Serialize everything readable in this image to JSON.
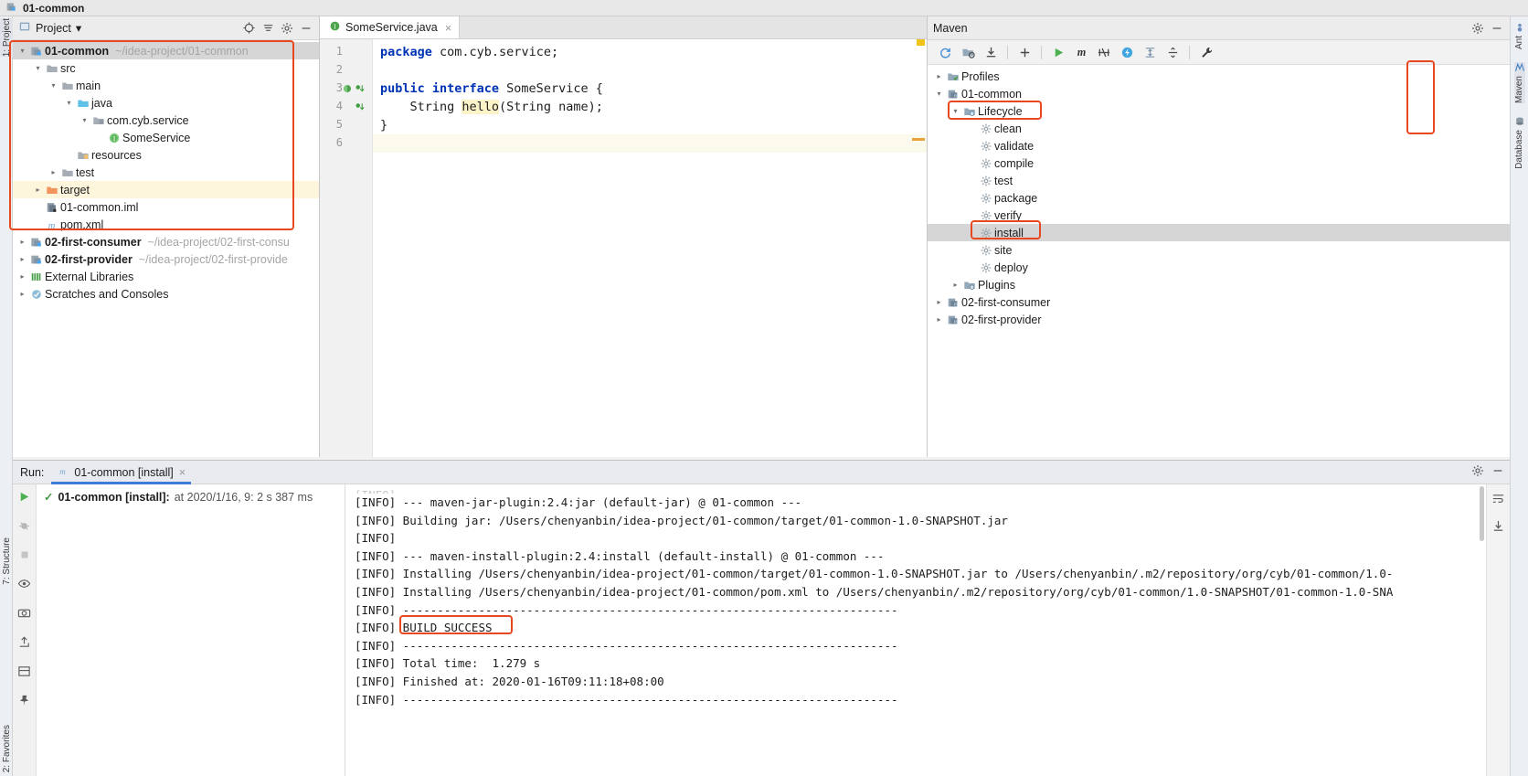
{
  "titlebar": {
    "project_name": "01-common",
    "icon": "module-icon"
  },
  "left_strip": {
    "project_tab": "1: Project",
    "structure_tab": "7: Structure",
    "favorites_tab": "2: Favorites"
  },
  "right_strip": {
    "ant_tab": "Ant",
    "maven_tab": "Maven",
    "database_tab": "Database"
  },
  "project_panel": {
    "header": {
      "title": "Project",
      "dropdown": "▾",
      "icons": [
        "locate-icon",
        "collapse-all-icon",
        "gear-icon",
        "minimize-icon"
      ]
    },
    "tree": [
      {
        "depth": 0,
        "arrow": "▾",
        "icon": "module-icon",
        "label": "01-common",
        "path": "~/idea-project/01-common",
        "bold": true,
        "selected": true
      },
      {
        "depth": 1,
        "arrow": "▾",
        "icon": "folder-icon",
        "label": "src",
        "path": "",
        "bold": false,
        "selected": false
      },
      {
        "depth": 2,
        "arrow": "▾",
        "icon": "folder-icon",
        "label": "main",
        "path": "",
        "bold": false,
        "selected": false
      },
      {
        "depth": 3,
        "arrow": "▾",
        "icon": "source-folder-icon",
        "label": "java",
        "path": "",
        "bold": false,
        "selected": false
      },
      {
        "depth": 4,
        "arrow": "▾",
        "icon": "package-icon",
        "label": "com.cyb.service",
        "path": "",
        "bold": false,
        "selected": false
      },
      {
        "depth": 5,
        "arrow": "",
        "icon": "interface-icon",
        "label": "SomeService",
        "path": "",
        "bold": false,
        "selected": false
      },
      {
        "depth": 3,
        "arrow": "",
        "icon": "resources-folder-icon",
        "label": "resources",
        "path": "",
        "bold": false,
        "selected": false
      },
      {
        "depth": 2,
        "arrow": "▸",
        "icon": "folder-icon",
        "label": "test",
        "path": "",
        "bold": false,
        "selected": false
      },
      {
        "depth": 1,
        "arrow": "▸",
        "icon": "target-folder-icon",
        "label": "target",
        "path": "",
        "bold": false,
        "selected": false,
        "highlight": true
      },
      {
        "depth": 1,
        "arrow": "",
        "icon": "iml-file-icon",
        "label": "01-common.iml",
        "path": "",
        "bold": false,
        "selected": false
      },
      {
        "depth": 1,
        "arrow": "",
        "icon": "maven-file-icon",
        "label": "pom.xml",
        "path": "",
        "bold": false,
        "selected": false
      },
      {
        "depth": 0,
        "arrow": "▸",
        "icon": "module-icon",
        "label": "02-first-consumer",
        "path": "~/idea-project/02-first-consu",
        "bold": true,
        "selected": false
      },
      {
        "depth": 0,
        "arrow": "▸",
        "icon": "module-icon",
        "label": "02-first-provider",
        "path": "~/idea-project/02-first-provide",
        "bold": true,
        "selected": false
      },
      {
        "depth": 0,
        "arrow": "▸",
        "icon": "libraries-icon",
        "label": "External Libraries",
        "path": "",
        "bold": false,
        "selected": false
      },
      {
        "depth": 0,
        "arrow": "▸",
        "icon": "scratches-icon",
        "label": "Scratches and Consoles",
        "path": "",
        "bold": false,
        "selected": false
      }
    ]
  },
  "editor": {
    "tab": {
      "label": "SomeService.java",
      "icon": "interface-icon",
      "close": "×"
    },
    "lines": [
      {
        "number": "1",
        "text": "package com.cyb.service;"
      },
      {
        "number": "2",
        "text": ""
      },
      {
        "number": "3",
        "text": "public interface SomeService {"
      },
      {
        "number": "4",
        "text": "    String hello(String name);"
      },
      {
        "number": "5",
        "text": "}"
      },
      {
        "number": "6",
        "text": ""
      }
    ],
    "code": {
      "l1_kw": "package",
      "l1_rest": " com.cyb.service;",
      "l3_kw": "public interface",
      "l3_rest": " SomeService {",
      "l4_pre": "    String ",
      "l4_hl": "hello",
      "l4_post": "(String name);",
      "l5": "}"
    },
    "gutter_icons": [
      "bookmark-green-icon",
      "run-gutter-icon",
      "implemented-icon"
    ]
  },
  "maven": {
    "title": "Maven",
    "header_icons": [
      "gear-icon",
      "minimize-icon"
    ],
    "toolbar": [
      "reload-icon",
      "generate-sources-icon",
      "download-sources-icon",
      "add-icon",
      "run-icon",
      "maven-goal-icon",
      "skip-tests-icon",
      "toggle-offline-icon",
      "expand-icon",
      "collapse-icon",
      "settings-wrench-icon"
    ],
    "tree": [
      {
        "depth": 0,
        "arrow": "▸",
        "icon": "profiles-icon",
        "label": "Profiles",
        "selected": false
      },
      {
        "depth": 0,
        "arrow": "▾",
        "icon": "maven-project-icon",
        "label": "01-common",
        "selected": false
      },
      {
        "depth": 1,
        "arrow": "▾",
        "icon": "lifecycle-icon",
        "label": "Lifecycle",
        "selected": false,
        "boxed": true
      },
      {
        "depth": 2,
        "arrow": "",
        "icon": "goal-icon",
        "label": "clean",
        "selected": false
      },
      {
        "depth": 2,
        "arrow": "",
        "icon": "goal-icon",
        "label": "validate",
        "selected": false
      },
      {
        "depth": 2,
        "arrow": "",
        "icon": "goal-icon",
        "label": "compile",
        "selected": false
      },
      {
        "depth": 2,
        "arrow": "",
        "icon": "goal-icon",
        "label": "test",
        "selected": false
      },
      {
        "depth": 2,
        "arrow": "",
        "icon": "goal-icon",
        "label": "package",
        "selected": false
      },
      {
        "depth": 2,
        "arrow": "",
        "icon": "goal-icon",
        "label": "verify",
        "selected": false
      },
      {
        "depth": 2,
        "arrow": "",
        "icon": "goal-icon",
        "label": "install",
        "selected": true,
        "boxed": true
      },
      {
        "depth": 2,
        "arrow": "",
        "icon": "goal-icon",
        "label": "site",
        "selected": false
      },
      {
        "depth": 2,
        "arrow": "",
        "icon": "goal-icon",
        "label": "deploy",
        "selected": false
      },
      {
        "depth": 1,
        "arrow": "▸",
        "icon": "plugins-icon",
        "label": "Plugins",
        "selected": false
      },
      {
        "depth": 0,
        "arrow": "▸",
        "icon": "maven-project-icon",
        "label": "02-first-consumer",
        "selected": false
      },
      {
        "depth": 0,
        "arrow": "▸",
        "icon": "maven-project-icon",
        "label": "02-first-provider",
        "selected": false
      }
    ]
  },
  "run_window": {
    "label": "Run:",
    "tab": {
      "label": "01-common [install]",
      "icon": "maven-file-icon",
      "close": "×"
    },
    "header_icons": [
      "gear-icon",
      "minimize-icon"
    ],
    "sidebar_icons": [
      "rerun-icon",
      "debug-icon",
      "stop-icon",
      "eye-icon",
      "camera-icon",
      "pin-icon",
      "export-icon"
    ],
    "right_icons": [
      "wrap-text-icon",
      "scroll-to-end-icon"
    ],
    "tree_entry": {
      "status_icon": "check-icon",
      "name": "01-common [install]:",
      "detail": "at 2020/1/16, 9:  2 s 387 ms"
    },
    "console_lines": [
      "[INFO]",
      "[INFO] --- maven-jar-plugin:2.4:jar (default-jar) @ 01-common ---",
      "[INFO] Building jar: /Users/chenyanbin/idea-project/01-common/target/01-common-1.0-SNAPSHOT.jar",
      "[INFO]",
      "[INFO] --- maven-install-plugin:2.4:install (default-install) @ 01-common ---",
      "[INFO] Installing /Users/chenyanbin/idea-project/01-common/target/01-common-1.0-SNAPSHOT.jar to /Users/chenyanbin/.m2/repository/org/cyb/01-common/1.0-",
      "[INFO] Installing /Users/chenyanbin/idea-project/01-common/pom.xml to /Users/chenyanbin/.m2/repository/org/cyb/01-common/1.0-SNAPSHOT/01-common-1.0-SNA",
      "[INFO] ------------------------------------------------------------------------",
      "[INFO] BUILD SUCCESS",
      "[INFO] ------------------------------------------------------------------------",
      "[INFO] Total time:  1.279 s",
      "[INFO] Finished at: 2020-01-16T09:11:18+08:00",
      "[INFO] ------------------------------------------------------------------------"
    ],
    "build_success_text": "BUILD SUCCESS"
  },
  "colors": {
    "annotation_red": "#e8481f",
    "accent_blue": "#3b7dd8",
    "keyword_blue": "#0033b3",
    "highlight_yellow": "#fdf3c8",
    "selection_gray": "#d6d6d6"
  }
}
